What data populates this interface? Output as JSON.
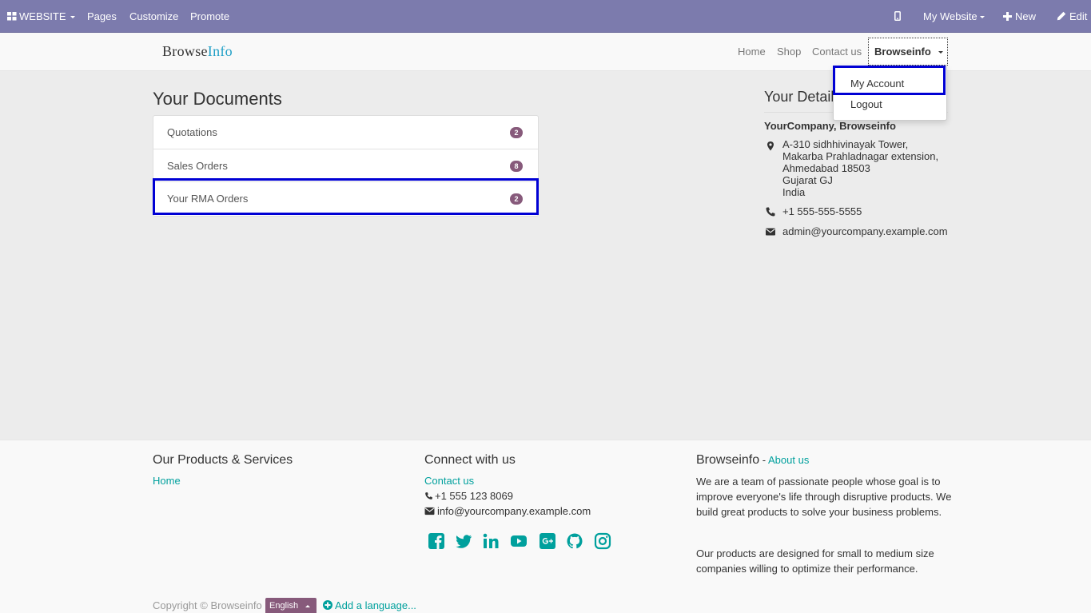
{
  "topbar": {
    "website": "WEBSITE",
    "pages": "Pages",
    "customize": "Customize",
    "promote": "Promote",
    "my_website": "My Website",
    "new": "New",
    "edit": "Edit"
  },
  "navbar": {
    "logo_main": "Browse",
    "logo_accent": "Info",
    "links": [
      "Home",
      "Shop",
      "Contact us"
    ],
    "user": "Browseinfo"
  },
  "dropdown": {
    "items": [
      "My Account",
      "Logout"
    ]
  },
  "documents": {
    "title": "Your Documents",
    "rows": [
      {
        "label": "Quotations",
        "count": "2"
      },
      {
        "label": "Sales Orders",
        "count": "8"
      },
      {
        "label": "Your RMA Orders",
        "count": "2"
      }
    ]
  },
  "details": {
    "title": "Your Details",
    "company": "YourCompany, Browseinfo",
    "address": [
      "A-310 sidhhivinayak Tower,",
      "Makarba Prahladnagar extension,",
      "Ahmedabad 18503",
      "Gujarat GJ",
      "India"
    ],
    "phone": "+1 555-555-5555",
    "email": "admin@yourcompany.example.com"
  },
  "footer": {
    "products_title": "Our Products & Services",
    "products_link": "Home",
    "connect_title": "Connect with us",
    "connect_link": "Contact us",
    "connect_phone": "+1 555 123 8069",
    "connect_email": "info@yourcompany.example.com",
    "about_title": "Browseinfo",
    "about_sep": " - ",
    "about_link": "About us",
    "about_p1": "We are a team of passionate people whose goal is to improve everyone's life through disruptive products. We build great products to solve your business problems.",
    "about_p2": "Our products are designed for small to medium size companies willing to optimize their performance.",
    "social": [
      "facebook-icon",
      "twitter-icon",
      "linkedin-icon",
      "youtube-icon",
      "google-plus-icon",
      "github-icon",
      "instagram-icon"
    ],
    "copyright": "Copyright © Browseinfo",
    "language": "English",
    "add_language": "Add a language..."
  },
  "colors": {
    "admin_bar": "#7c7bad",
    "accent": "#00a09d",
    "badge": "#875a7b",
    "highlight": "#0000d4"
  }
}
